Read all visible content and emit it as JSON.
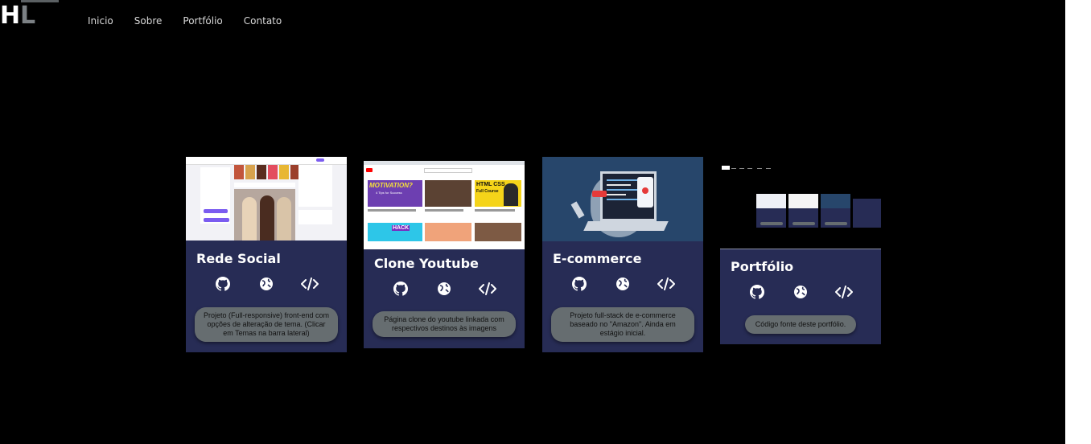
{
  "brand": {
    "logo_h": "H",
    "logo_l": "L"
  },
  "nav": {
    "items": [
      "Inicio",
      "Sobre",
      "Portfólio",
      "Contato"
    ]
  },
  "projects": [
    {
      "title": "Rede Social",
      "description": "Projeto (Full-responsive) front-end com opções de alteração de tema. (Clicar em Temas na barra lateral)"
    },
    {
      "title": "Clone Youtube",
      "description": "Página clone do youtube linkada com respectivos destinos às imagens",
      "thumb_text": {
        "card1_line1": "MOTIVATION?",
        "card1_line2": "4 Tips for Success",
        "card3_line1": "HTML CSS",
        "card3_line2": "Full Course",
        "card4": "HACK"
      }
    },
    {
      "title": "E-commerce",
      "description": "Projeto full-stack de e-commerce baseado no \"Amazon\". Ainda em estágio inicial."
    },
    {
      "title": "Portfólio",
      "description": "Código fonte deste portfólio."
    }
  ],
  "icons": [
    "github-icon",
    "globe-icon",
    "code-icon"
  ],
  "colors": {
    "card_bg": "#272c55",
    "desc_bg": "#666d70",
    "page_bg": "#000000"
  }
}
